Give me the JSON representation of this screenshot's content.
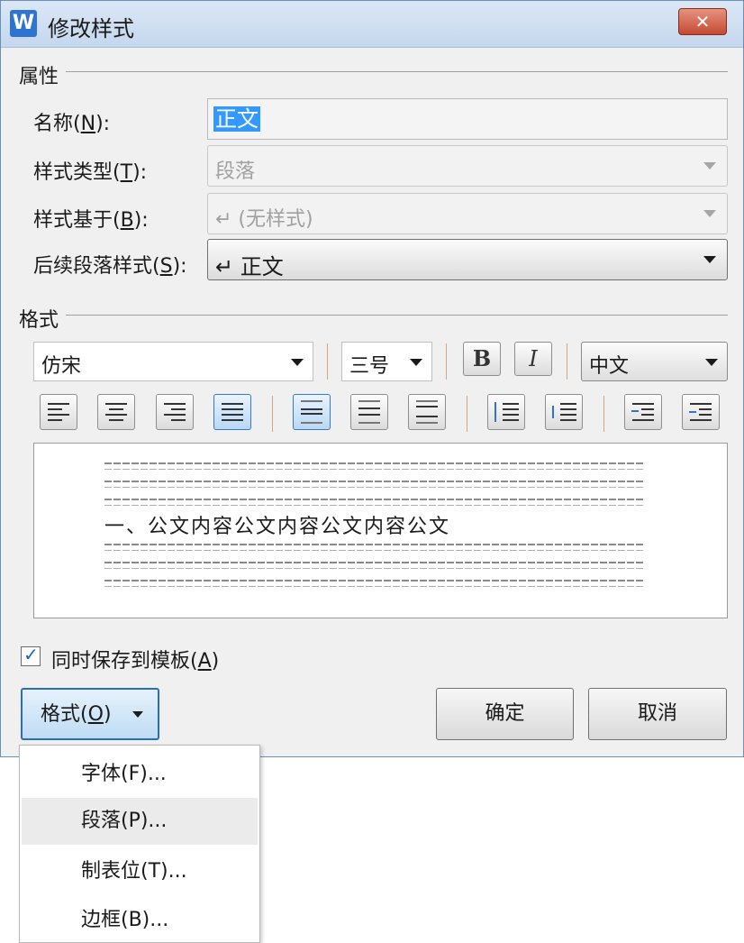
{
  "window": {
    "title": "修改样式",
    "app_icon": "W",
    "close_glyph": "✕"
  },
  "sections": {
    "properties": "属性",
    "format": "格式"
  },
  "properties": {
    "name_label": "名称",
    "name_key": "N",
    "name_value": "正文",
    "type_label": "样式类型",
    "type_key": "T",
    "type_value": "段落",
    "based_label": "样式基于",
    "based_key": "B",
    "based_value": "↵ (无样式)",
    "next_label": "后续段落样式",
    "next_key": "S",
    "next_value": "↵ 正文"
  },
  "format": {
    "font": "仿宋",
    "size": "三号",
    "bold": "B",
    "italic": "I",
    "script": "中文"
  },
  "preview": {
    "main_text": "一、公文内容公文内容公文内容公文"
  },
  "checkbox": {
    "label": "同时保存到模板",
    "key": "A",
    "checked": true,
    "tick": "✓"
  },
  "buttons": {
    "format_label": "格式",
    "format_key": "O",
    "ok": "确定",
    "cancel": "取消"
  },
  "menu": {
    "items": [
      "字体(F)...",
      "段落(P)...",
      "制表位(T)...",
      "边框(B)..."
    ],
    "highlighted_index": 1
  }
}
